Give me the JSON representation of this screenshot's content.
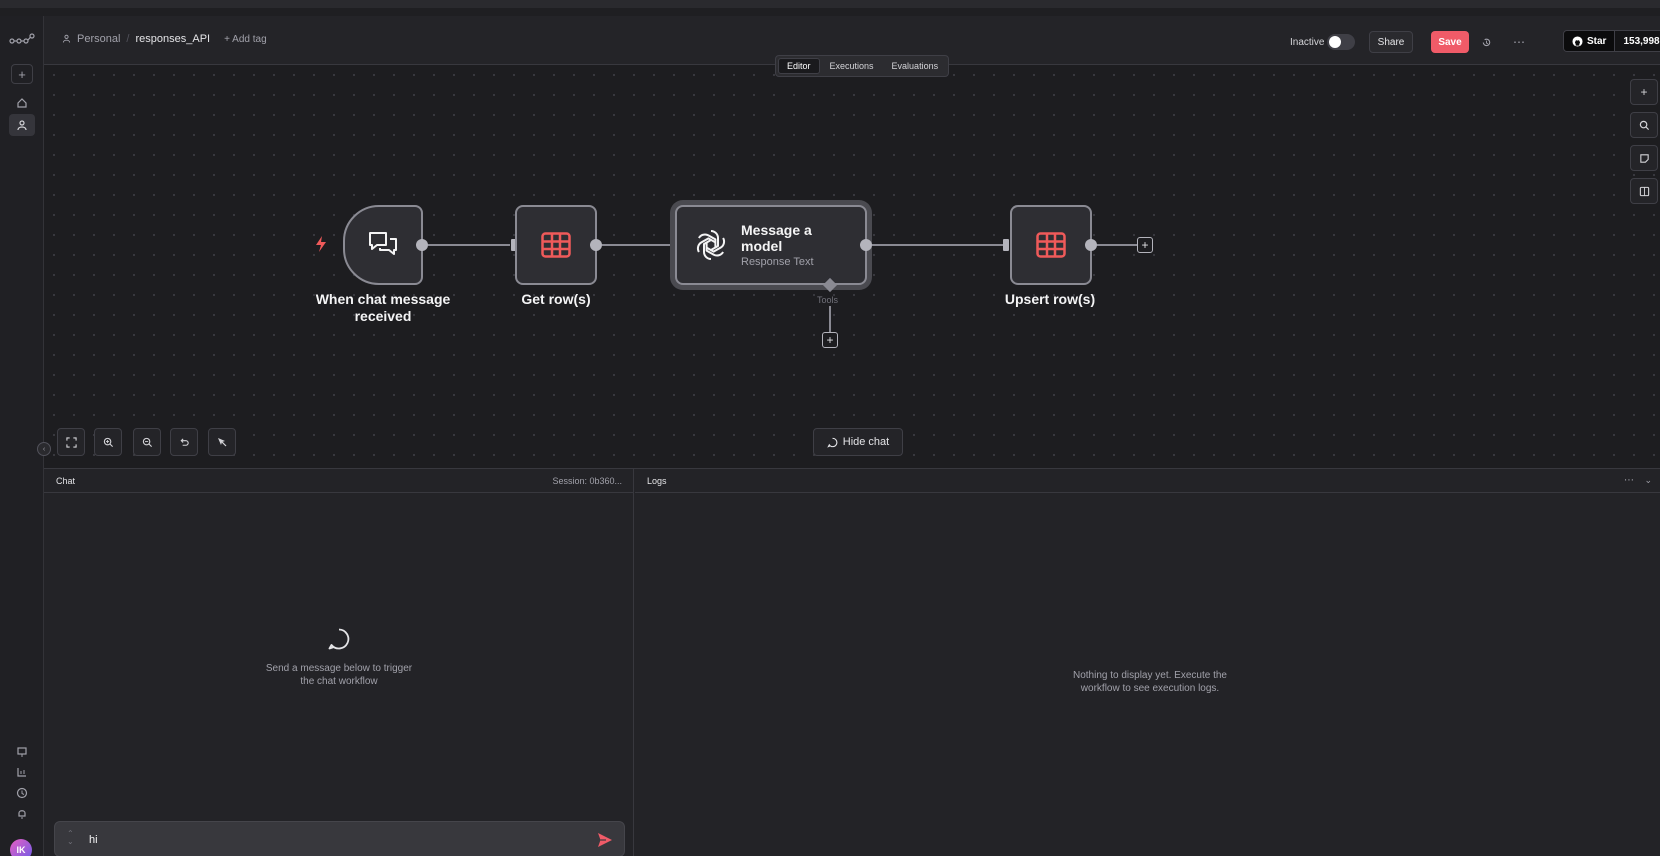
{
  "header": {
    "project": "Personal",
    "workflow_name": "responses_API",
    "add_tag": "+ Add tag",
    "status_label": "Inactive",
    "share_label": "Share",
    "save_label": "Save",
    "github_star_label": "Star",
    "github_star_count": "153,998"
  },
  "tabs": [
    "Editor",
    "Executions",
    "Evaluations"
  ],
  "nodes": {
    "chat_trigger": {
      "label_line1": "When chat message",
      "label_line2": "received"
    },
    "get_rows": {
      "label": "Get row(s)"
    },
    "message_model": {
      "title_line1": "Message a",
      "title_line2": "model",
      "subtitle": "Response Text",
      "tools_label": "Tools"
    },
    "upsert_rows": {
      "label": "Upsert row(s)"
    }
  },
  "canvas_controls": {
    "hide_chat": "Hide chat"
  },
  "chat_panel": {
    "title": "Chat",
    "session": "Session: 0b360...",
    "empty_line1": "Send a message below to trigger",
    "empty_line2": "the chat workflow",
    "input_value": "hi"
  },
  "logs_panel": {
    "title": "Logs",
    "empty_line1": "Nothing to display yet. Execute the",
    "empty_line2": "workflow to see execution logs."
  },
  "user": {
    "initials": "IK"
  },
  "colors": {
    "accent": "#f05b68",
    "table_icon": "#ef5a5a",
    "trigger_bolt": "#ef5a5a"
  }
}
